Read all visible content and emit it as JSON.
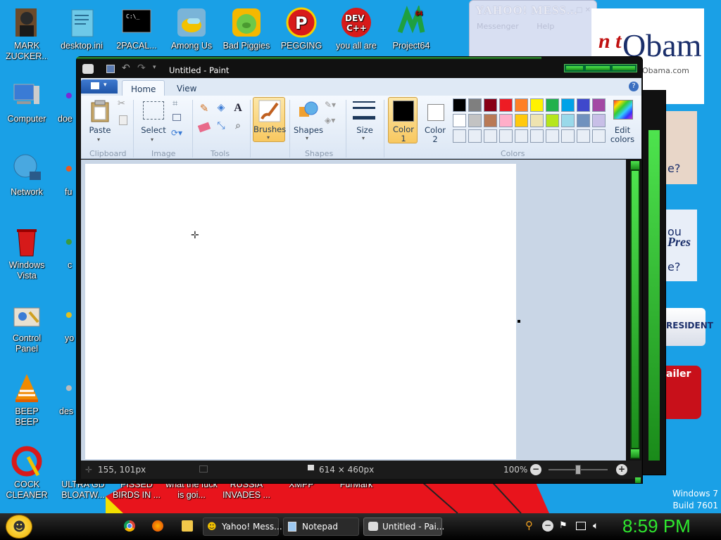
{
  "desktop_icons": [
    {
      "label": "MARK ZUCKER...",
      "icon": "mark-zuckerberg-icon"
    },
    {
      "label": "desktop.ini",
      "icon": "config-file-icon"
    },
    {
      "label": "2PACAL...",
      "icon": "console-icon"
    },
    {
      "label": "Among Us",
      "icon": "among-us-icon"
    },
    {
      "label": "Bad Piggies",
      "icon": "bad-piggies-icon"
    },
    {
      "label": "PEGGING",
      "icon": "pegging-icon"
    },
    {
      "label": "you all are",
      "icon": "dev-cpp-icon"
    },
    {
      "label": "Project64",
      "icon": "project64-icon"
    },
    {
      "label": "Computer",
      "icon": "computer-icon"
    },
    {
      "label": "doe",
      "icon": "app-icon"
    },
    {
      "label": "Network",
      "icon": "network-icon"
    },
    {
      "label": "fu",
      "icon": "app-icon"
    },
    {
      "label": "Windows Vista",
      "icon": "recycle-bin-icon"
    },
    {
      "label": "c",
      "icon": "app-icon"
    },
    {
      "label": "Control Panel",
      "icon": "control-panel-icon"
    },
    {
      "label": "yo",
      "icon": "app-icon"
    },
    {
      "label": "BEEP BEEP",
      "icon": "vlc-icon"
    },
    {
      "label": "des",
      "icon": "app-icon"
    },
    {
      "label": "COCK CLEANER",
      "icon": "ccleaner-icon"
    },
    {
      "label": "ULTRA GD BLOATW...",
      "icon": "app-icon"
    },
    {
      "label": "PISSED BIRDS IN ...",
      "icon": "app-icon"
    },
    {
      "label": "what the fuck is goi...",
      "icon": "app-icon"
    },
    {
      "label": "RUSSIA INVADES ...",
      "icon": "app-icon"
    },
    {
      "label": "XMPP",
      "icon": "app-icon"
    },
    {
      "label": "FurMark",
      "icon": "app-icon"
    }
  ],
  "yahoo_window": {
    "title": "YAHOO! MESS...",
    "menu": [
      "Messenger",
      "Help"
    ]
  },
  "ad_text": {
    "obama": "Obam",
    "obama_url": "Obama.com",
    "you": "ou",
    "president_word": "Pres",
    "q": "e?",
    "president": "RESIDENT",
    "trailer": "ailer"
  },
  "paint": {
    "title": "Untitled - Paint",
    "tabs": [
      "Home",
      "View"
    ],
    "groups": {
      "clipboard": "Clipboard",
      "image": "Image",
      "tools": "Tools",
      "shapes": "Shapes",
      "colors": "Colors"
    },
    "buttons": {
      "paste": "Paste",
      "select": "Select",
      "brushes": "Brushes",
      "shapes": "Shapes",
      "size": "Size",
      "color1_a": "Color",
      "color1_b": "1",
      "color2_a": "Color",
      "color2_b": "2",
      "edit_colors_a": "Edit",
      "edit_colors_b": "colors"
    },
    "status": {
      "cursor_pos": "155, 101px",
      "canvas_size": "614 × 460px",
      "zoom": "100%"
    },
    "selected_color1": "#000000",
    "selected_color2": "#ffffff",
    "palette_row1": [
      "#000000",
      "#7f7f7f",
      "#880015",
      "#ed1c24",
      "#ff7f27",
      "#fff200",
      "#22b14c",
      "#00a2e8",
      "#3f48cc",
      "#a349a4"
    ],
    "palette_row2": [
      "#ffffff",
      "#c3c3c3",
      "#b97a57",
      "#ffaec9",
      "#ffc90e",
      "#efe4b0",
      "#b5e61d",
      "#99d9ea",
      "#7092be",
      "#c8bfe7"
    ]
  },
  "watermark": {
    "line1": "Windows 7",
    "line2": "Build 7601"
  },
  "taskbar": {
    "items": [
      "Yahoo! Mess...",
      "Notepad",
      "Untitled - Pai..."
    ],
    "clock": "8:59 PM"
  }
}
